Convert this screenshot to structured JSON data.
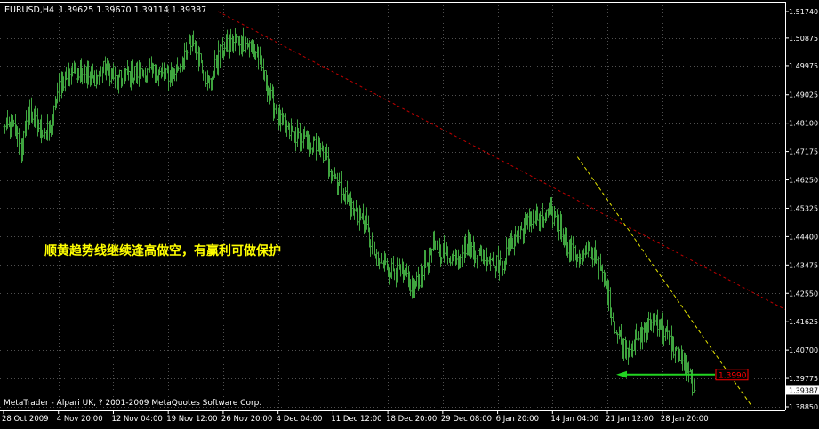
{
  "header": {
    "symbol_label": "EURUSD,H4",
    "ohlc": "1.39625 1.39670 1.39114 1.39387"
  },
  "footer": {
    "copyright": "MetaTrader - Alpari UK, ? 2001-2009 MetaQuotes Software Corp."
  },
  "annotation": {
    "text": "顺黄趋势线继续逢高做空，有赢利可做保护"
  },
  "price_labels": {
    "current": "1.39387",
    "marker": "1.3990"
  },
  "colors": {
    "background": "#000000",
    "axis": "#ffffff",
    "grid": "#505050",
    "bar": "#3fa43f",
    "red_trend": "#c00000",
    "yellow_trend": "#e6e600",
    "arrow": "#22d422",
    "annotation": "#ffff00",
    "marker_border": "#ff0000"
  },
  "chart_data": {
    "type": "ohlc-bar",
    "symbol": "EURUSD",
    "timeframe": "H4",
    "y_ticks": [
      "1.51740",
      "1.50875",
      "1.49975",
      "1.49025",
      "1.48100",
      "1.47175",
      "1.46250",
      "1.45325",
      "1.44400",
      "1.43475",
      "1.42550",
      "1.41625",
      "1.40700",
      "1.39775",
      "1.38850"
    ],
    "ylim": [
      1.3885,
      1.5174
    ],
    "x_ticks": [
      "28 Oct 2009",
      "4 Nov 20:00",
      "12 Nov 04:00",
      "19 Nov 12:00",
      "26 Nov 20:00",
      "4 Dec 04:00",
      "11 Dec 12:00",
      "18 Dec 20:00",
      "29 Dec 08:00",
      "6 Jan 20:00",
      "14 Jan 04:00",
      "21 Jan 12:00",
      "28 Jan 20:00"
    ],
    "x_tick_index": [
      0,
      44,
      88,
      132,
      176,
      220,
      264,
      308,
      352,
      396,
      440,
      484,
      528
    ],
    "bar_count": 555,
    "anchors": [
      [
        0,
        1.479
      ],
      [
        8,
        1.48
      ],
      [
        15,
        1.473
      ],
      [
        22,
        1.485
      ],
      [
        30,
        1.479
      ],
      [
        38,
        1.478
      ],
      [
        45,
        1.493
      ],
      [
        55,
        1.498
      ],
      [
        64,
        1.498
      ],
      [
        72,
        1.495
      ],
      [
        82,
        1.499
      ],
      [
        92,
        1.495
      ],
      [
        102,
        1.497
      ],
      [
        112,
        1.497
      ],
      [
        122,
        1.498
      ],
      [
        130,
        1.496
      ],
      [
        138,
        1.498
      ],
      [
        146,
        1.502
      ],
      [
        152,
        1.508
      ],
      [
        158,
        1.503
      ],
      [
        165,
        1.493
      ],
      [
        172,
        1.502
      ],
      [
        180,
        1.506
      ],
      [
        188,
        1.508
      ],
      [
        196,
        1.507
      ],
      [
        204,
        1.504
      ],
      [
        210,
        1.496
      ],
      [
        216,
        1.488
      ],
      [
        222,
        1.482
      ],
      [
        230,
        1.478
      ],
      [
        240,
        1.476
      ],
      [
        250,
        1.474
      ],
      [
        258,
        1.47
      ],
      [
        266,
        1.464
      ],
      [
        274,
        1.458
      ],
      [
        282,
        1.452
      ],
      [
        290,
        1.449
      ],
      [
        300,
        1.436
      ],
      [
        310,
        1.434
      ],
      [
        320,
        1.431
      ],
      [
        330,
        1.427
      ],
      [
        338,
        1.434
      ],
      [
        346,
        1.441
      ],
      [
        354,
        1.439
      ],
      [
        362,
        1.437
      ],
      [
        372,
        1.441
      ],
      [
        382,
        1.438
      ],
      [
        392,
        1.437
      ],
      [
        400,
        1.434
      ],
      [
        408,
        1.442
      ],
      [
        416,
        1.446
      ],
      [
        424,
        1.45
      ],
      [
        432,
        1.449
      ],
      [
        438,
        1.452
      ],
      [
        446,
        1.448
      ],
      [
        452,
        1.442
      ],
      [
        458,
        1.438
      ],
      [
        466,
        1.437
      ],
      [
        474,
        1.439
      ],
      [
        480,
        1.432
      ],
      [
        486,
        1.424
      ],
      [
        492,
        1.413
      ],
      [
        500,
        1.407
      ],
      [
        508,
        1.41
      ],
      [
        516,
        1.414
      ],
      [
        524,
        1.417
      ],
      [
        532,
        1.412
      ],
      [
        540,
        1.406
      ],
      [
        548,
        1.401
      ],
      [
        555,
        1.3939
      ]
    ],
    "last_bar": {
      "open": 1.39625,
      "high": 1.3967,
      "low": 1.39114,
      "close": 1.39387
    },
    "trendlines": [
      {
        "color": "red",
        "style": "dashed",
        "from": {
          "bar": 172,
          "price": 1.5174
        },
        "to": {
          "bar": 665,
          "price": 1.412
        }
      },
      {
        "color": "yellow",
        "style": "dashed",
        "from": {
          "bar": 460,
          "price": 1.47
        },
        "to": {
          "bar": 600,
          "price": 1.3885
        }
      }
    ],
    "marker_level": 1.399,
    "grid": true
  }
}
